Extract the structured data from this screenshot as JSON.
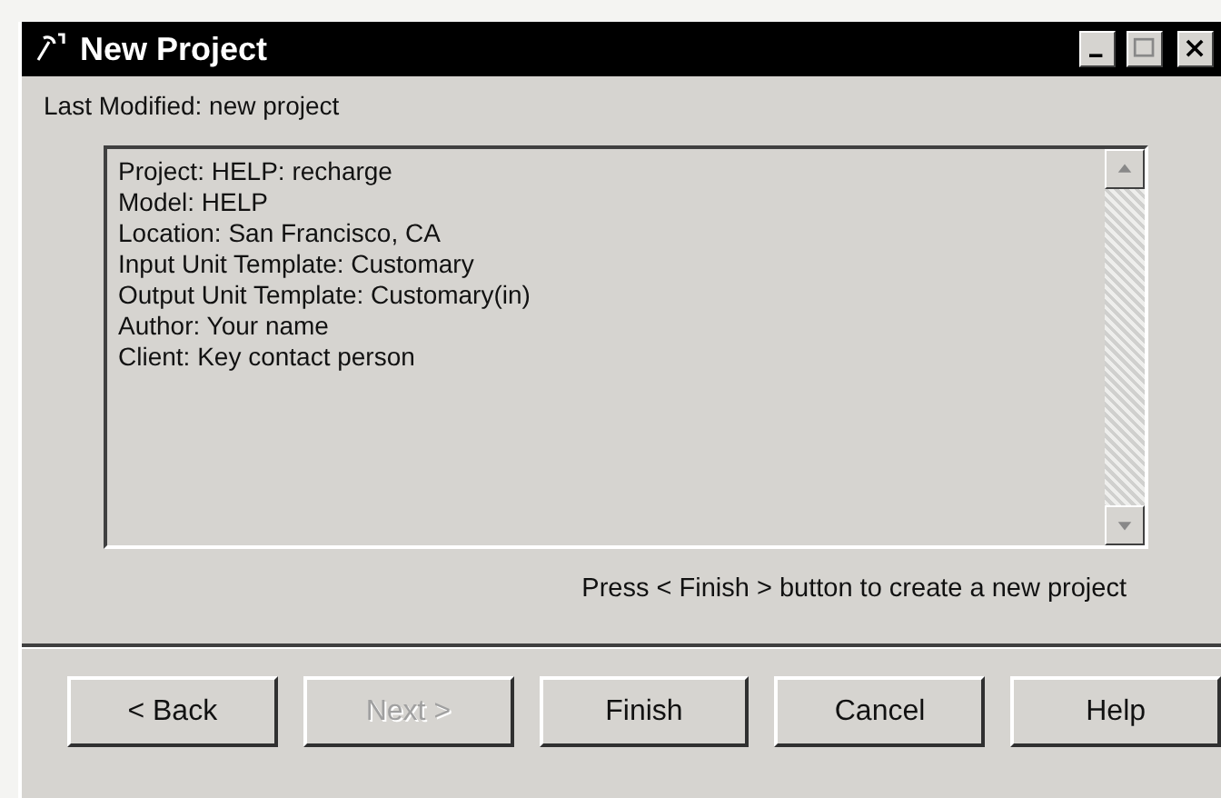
{
  "window": {
    "title": "New Project"
  },
  "last_modified": {
    "label": "Last Modified:",
    "value": "new project"
  },
  "details": [
    "Project: HELP: recharge",
    "Model: HELP",
    "Location: San Francisco, CA",
    "Input Unit Template: Customary",
    "Output Unit Template: Customary(in)",
    "Author: Your name",
    "Client: Key contact person"
  ],
  "hint": "Press < Finish > button to create a new project",
  "buttons": [
    {
      "label": "< Back",
      "disabled": false
    },
    {
      "label": "Next >",
      "disabled": true
    },
    {
      "label": "Finish",
      "disabled": false
    },
    {
      "label": "Cancel",
      "disabled": false
    },
    {
      "label": "Help",
      "disabled": false
    }
  ]
}
